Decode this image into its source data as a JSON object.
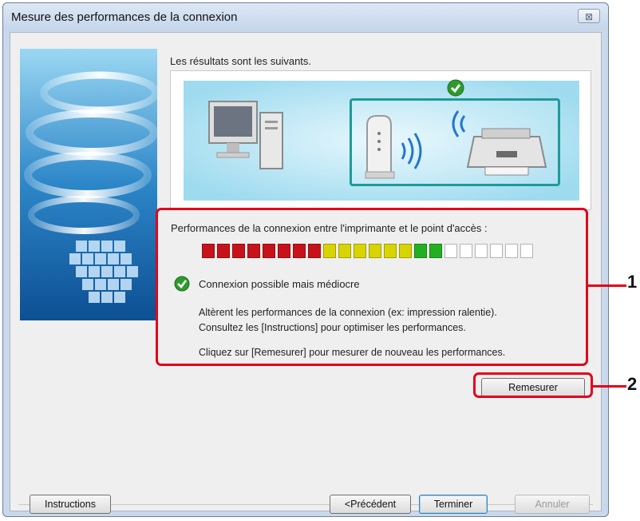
{
  "window": {
    "title": "Mesure des performances de la connexion",
    "close_glyph": "⊠"
  },
  "results_label": "Les résultats sont les suivants.",
  "performance": {
    "label": "Performances de la connexion entre l'imprimante et le point d'accès :",
    "level": {
      "filled": 16,
      "total": 22
    },
    "status": "Connexion possible mais médiocre",
    "description_line1": "Altèrent les performances de la connexion (ex: impression ralentie).",
    "description_line2": "Consultez les [Instructions] pour optimiser les performances.",
    "remeasure_hint": "Cliquez sur [Remesurer] pour mesurer de nouveau les performances."
  },
  "buttons": {
    "remesurer": "Remesurer",
    "instructions": "Instructions",
    "precedent": "<Précédent",
    "terminer": "Terminer",
    "annuler": "Annuler"
  },
  "callouts": [
    "1",
    "2"
  ],
  "colors": {
    "callout": "#e3001b",
    "meter_red": "#c8121a",
    "meter_yellow": "#d8d400",
    "meter_green": "#22b022",
    "meter_empty": "#ffffff",
    "check_green": "#2e9a2e"
  },
  "icons": [
    "computer-icon",
    "access-point-icon",
    "printer-icon",
    "checkmark-icon",
    "signal-wave-icon"
  ]
}
